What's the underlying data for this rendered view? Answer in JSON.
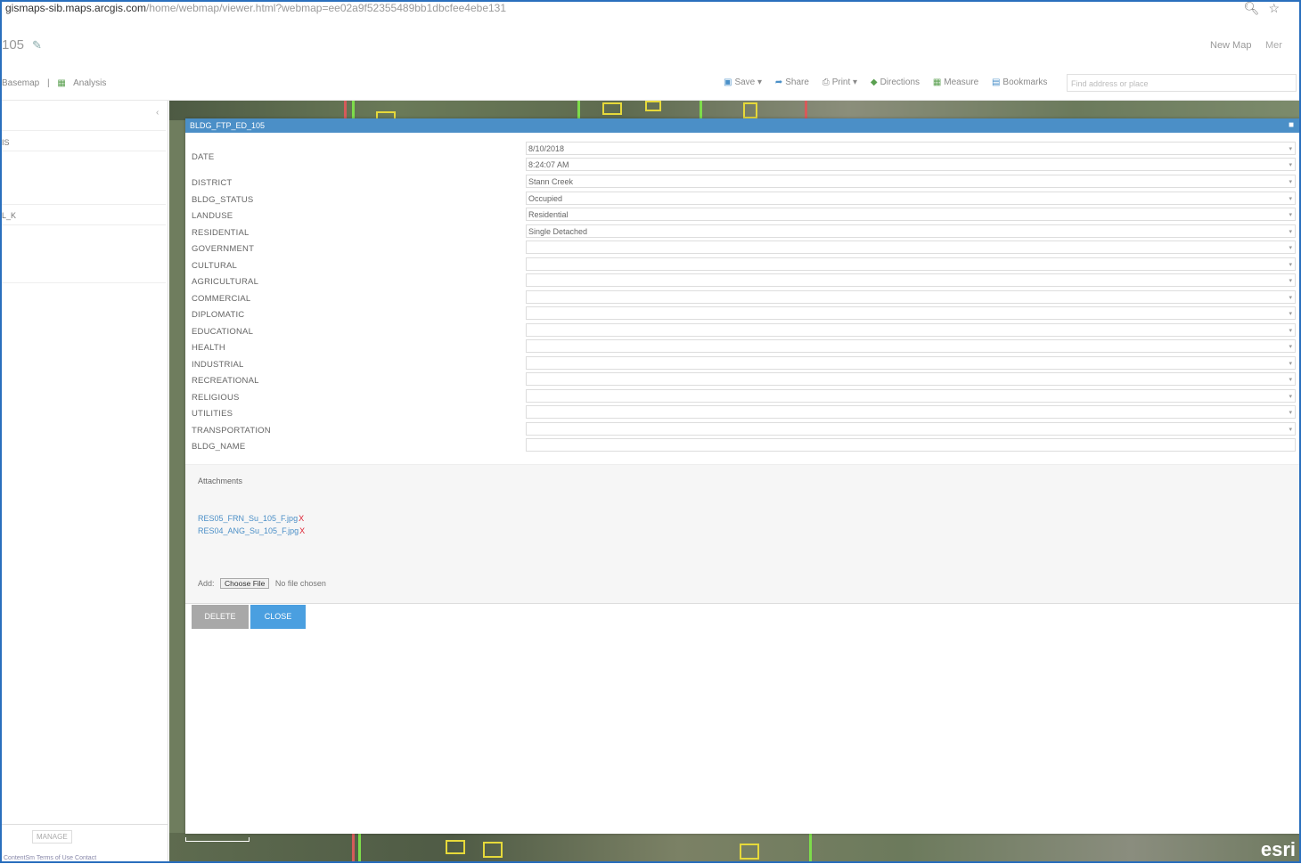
{
  "browser": {
    "url_host": "gismaps-sib.maps.arcgis.com",
    "url_path": "/home/webmap/viewer.html?webmap=ee02a9f52355489bb1dbcfee4ebe131"
  },
  "header": {
    "map_title": "105",
    "new_map": "New Map",
    "more": "Mer"
  },
  "toolbar": {
    "basemap": "Basemap",
    "analysis": "Analysis",
    "save": "Save",
    "share": "Share",
    "print": "Print",
    "directions": "Directions",
    "measure": "Measure",
    "bookmarks": "Bookmarks",
    "search_placeholder": "Find address or place"
  },
  "left_panel": {
    "row1": "IS",
    "row2": "L_K",
    "manage": "MANAGE",
    "footer_link": "ContentSm Terms of Use Contact"
  },
  "popup": {
    "title": "BLDG_FTP_ED_105",
    "fields": [
      {
        "label": "DATE",
        "value": "8/10/2018"
      },
      {
        "label": "",
        "value": "8:24:07 AM"
      },
      {
        "label": "DISTRICT",
        "value": "Stann Creek"
      },
      {
        "label": "BLDG_STATUS",
        "value": "Occupied"
      },
      {
        "label": "LANDUSE",
        "value": "Residential"
      },
      {
        "label": "RESIDENTIAL",
        "value": "Single Detached"
      },
      {
        "label": "GOVERNMENT",
        "value": ""
      },
      {
        "label": "CULTURAL",
        "value": ""
      },
      {
        "label": "AGRICULTURAL",
        "value": ""
      },
      {
        "label": "COMMERCIAL",
        "value": ""
      },
      {
        "label": "DIPLOMATIC",
        "value": ""
      },
      {
        "label": "EDUCATIONAL",
        "value": ""
      },
      {
        "label": "HEALTH",
        "value": ""
      },
      {
        "label": "INDUSTRIAL",
        "value": ""
      },
      {
        "label": "RECREATIONAL",
        "value": ""
      },
      {
        "label": "RELIGIOUS",
        "value": ""
      },
      {
        "label": "UTILITIES",
        "value": ""
      },
      {
        "label": "TRANSPORTATION",
        "value": ""
      },
      {
        "label": "BLDG_NAME",
        "value": ""
      }
    ],
    "attachments_title": "Attachments",
    "attachments": [
      "RES05_FRN_Su_105_F.jpg",
      "RES04_ANG_Su_105_F.jpg"
    ],
    "add_label": "Add:",
    "choose_file": "Choose File",
    "no_file": "No file chosen",
    "delete": "DELETE",
    "close": "CLOSE"
  },
  "map": {
    "attribution": "esri"
  }
}
